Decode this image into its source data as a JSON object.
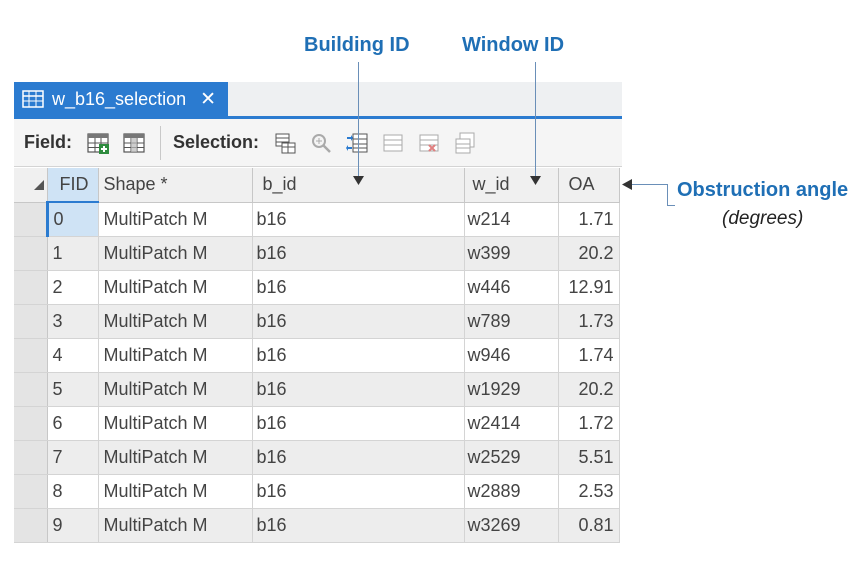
{
  "annotations": {
    "building_id": "Building ID",
    "window_id": "Window ID",
    "obstruction_angle": "Obstruction angle",
    "degrees": "(degrees)"
  },
  "tab": {
    "title": "w_b16_selection",
    "close": "✕",
    "icon": "table-icon"
  },
  "toolbar": {
    "field_label": "Field:",
    "selection_label": "Selection:",
    "field_icons": [
      "add-field-icon",
      "calculate-field-icon"
    ],
    "selection_icons": [
      "select-by-attributes-icon",
      "zoom-to-selection-icon",
      "switch-selection-icon",
      "clear-selection-icon",
      "delete-selection-icon",
      "copy-selection-icon"
    ]
  },
  "table": {
    "columns": [
      "FID",
      "Shape *",
      "b_id",
      "w_id",
      "OA"
    ],
    "rows": [
      [
        "0",
        "MultiPatch M",
        "b16",
        "w214",
        "1.71"
      ],
      [
        "1",
        "MultiPatch M",
        "b16",
        "w399",
        "20.2"
      ],
      [
        "2",
        "MultiPatch M",
        "b16",
        "w446",
        "12.91"
      ],
      [
        "3",
        "MultiPatch M",
        "b16",
        "w789",
        "1.73"
      ],
      [
        "4",
        "MultiPatch M",
        "b16",
        "w946",
        "1.74"
      ],
      [
        "5",
        "MultiPatch M",
        "b16",
        "w1929",
        "20.2"
      ],
      [
        "6",
        "MultiPatch M",
        "b16",
        "w2414",
        "1.72"
      ],
      [
        "7",
        "MultiPatch M",
        "b16",
        "w2529",
        "5.51"
      ],
      [
        "8",
        "MultiPatch M",
        "b16",
        "w2889",
        "2.53"
      ],
      [
        "9",
        "MultiPatch M",
        "b16",
        "w3269",
        "0.81"
      ]
    ]
  },
  "colors": {
    "accent": "#2b7bd0",
    "annotation": "#1f6fb5"
  }
}
